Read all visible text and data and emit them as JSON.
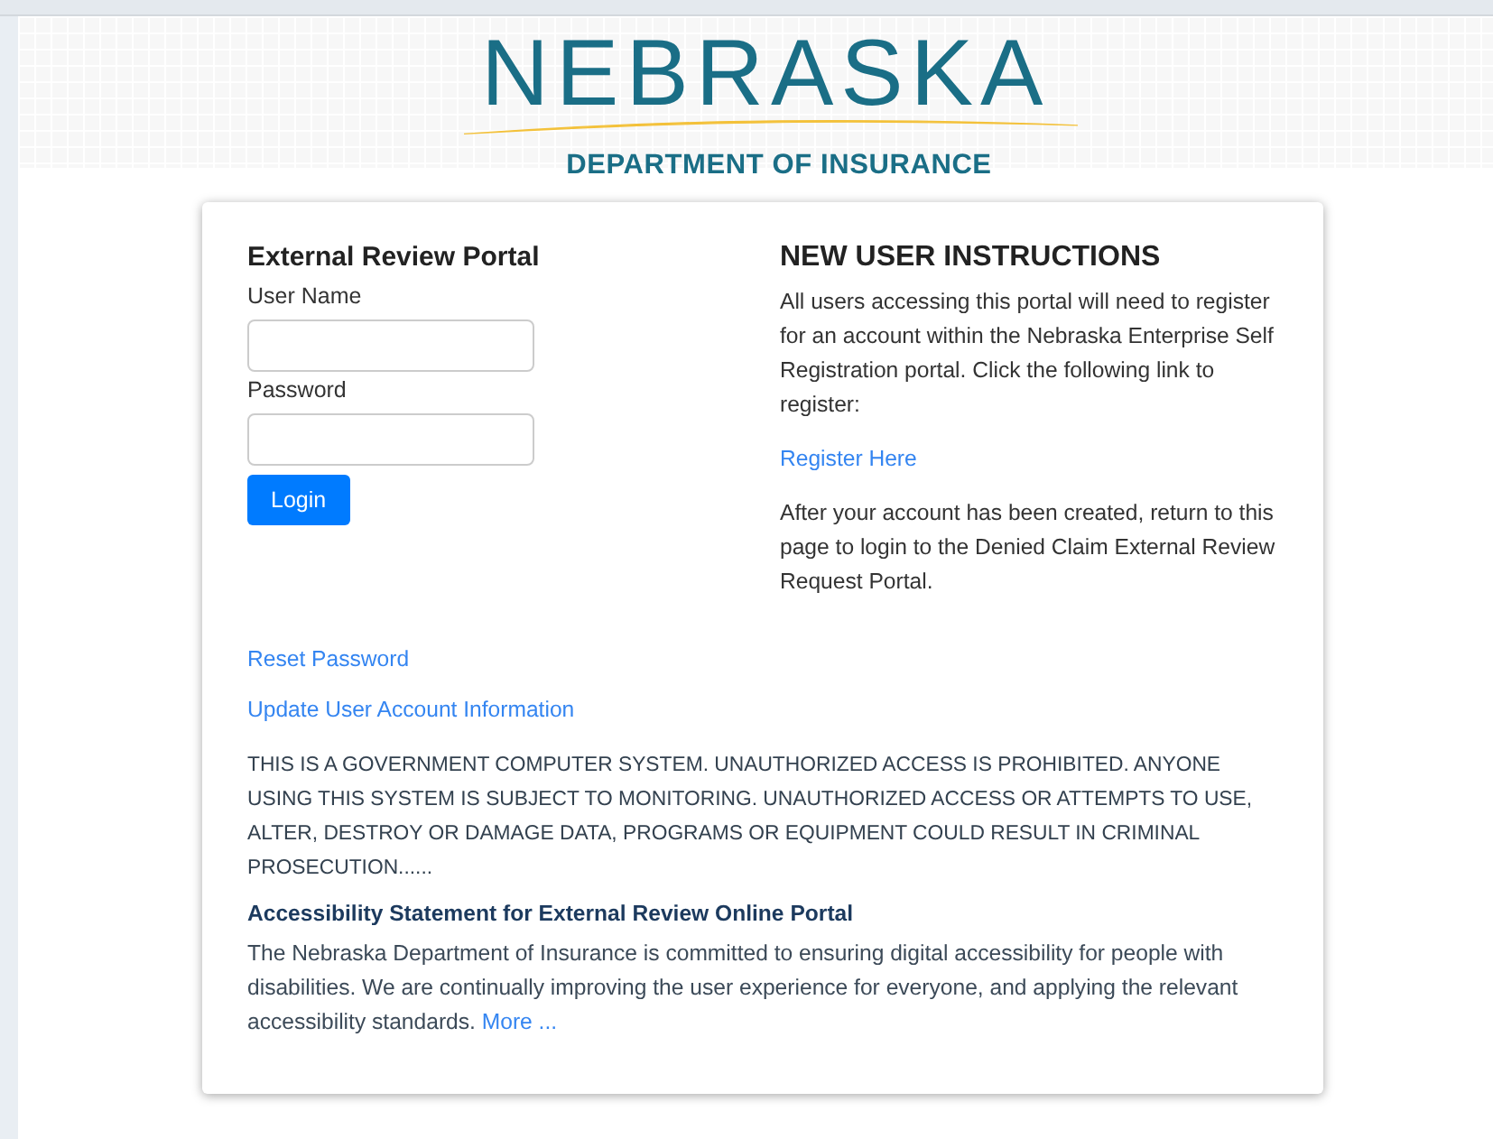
{
  "header": {
    "logo": "NEBRASKA",
    "subtitle": "DEPARTMENT OF INSURANCE"
  },
  "login": {
    "title": "External Review Portal",
    "fields": [
      {
        "label": "User Name"
      },
      {
        "label": "Password"
      }
    ],
    "button": "Login"
  },
  "instructions": {
    "title": "NEW USER INSTRUCTIONS",
    "paragraphs": [
      {
        "kind": "text",
        "text": "All users accessing this portal will need to register for an account within the Nebraska Enterprise Self Registration portal. Click the following link to register:"
      },
      {
        "kind": "link",
        "text": "Register Here"
      },
      {
        "kind": "text",
        "text": "After your account has been created, return to this page to login to the Denied Claim External Review Request Portal."
      }
    ]
  },
  "links": [
    "Reset Password",
    "Update User Account Information"
  ],
  "warning": "THIS IS A GOVERNMENT COMPUTER SYSTEM. UNAUTHORIZED ACCESS IS PROHIBITED. ANYONE USING THIS SYSTEM IS SUBJECT TO MONITORING. UNAUTHORIZED ACCESS OR ATTEMPTS TO USE, ALTER, DESTROY OR DAMAGE DATA, PROGRAMS OR EQUIPMENT COULD RESULT IN CRIMINAL PROSECUTION......",
  "accessibility": {
    "title": "Accessibility Statement for External Review Online Portal",
    "text": "The Nebraska Department of Insurance is committed to ensuring digital accessibility for people with disabilities. We are continually improving the user experience for everyone, and applying the relevant accessibility standards.",
    "link": "More ..."
  }
}
